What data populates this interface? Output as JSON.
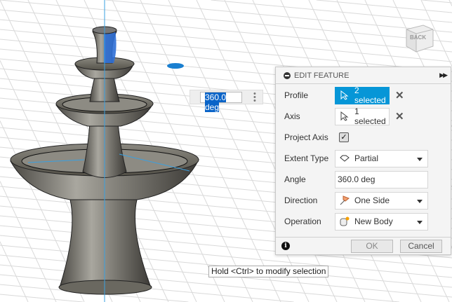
{
  "viewport": {
    "viewcube_label": "BACK",
    "angle_input_value": "360.0 deg",
    "tooltip": "Hold <Ctrl> to modify selection"
  },
  "panel": {
    "title": "EDIT FEATURE",
    "rows": {
      "profile": {
        "label": "Profile",
        "value": "2 selected"
      },
      "axis": {
        "label": "Axis",
        "value": "1 selected"
      },
      "project_axis": {
        "label": "Project Axis",
        "checked": true
      },
      "extent_type": {
        "label": "Extent Type",
        "value": "Partial"
      },
      "angle": {
        "label": "Angle",
        "value": "360.0 deg"
      },
      "direction": {
        "label": "Direction",
        "value": "One Side"
      },
      "operation": {
        "label": "Operation",
        "value": "New Body"
      }
    },
    "ok_label": "OK",
    "cancel_label": "Cancel",
    "check_glyph": "✓",
    "info_glyph": "i"
  },
  "colors": {
    "accent": "#0696d7",
    "selection": "#0a64c8"
  }
}
